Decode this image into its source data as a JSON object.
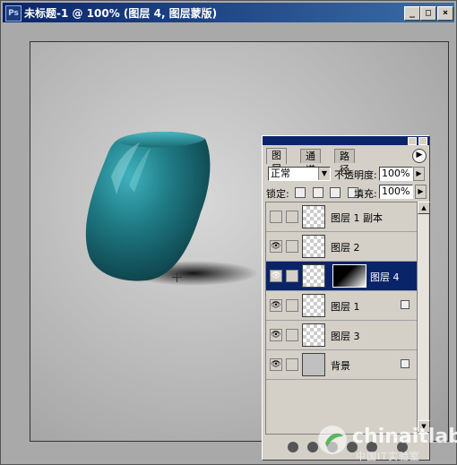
{
  "window": {
    "title": "未标题-1 @ 100% (图层 4, 图层蒙版)",
    "icon": "photoshop-icon",
    "controls": [
      "_",
      "□",
      "×"
    ]
  },
  "layers_panel": {
    "tabs": [
      "图层",
      "通道",
      "路径"
    ],
    "active_tab": "图层",
    "blend_mode": "正常",
    "opacity_label": "不透明度:",
    "opacity_value": "100%",
    "lock_label": "锁定:",
    "fill_label": "填充:",
    "fill_value": "100%",
    "layers": [
      {
        "name": "图层 1 副本",
        "visible": false,
        "thumb": "line",
        "locked": false,
        "selected": false
      },
      {
        "name": "图层 2",
        "visible": true,
        "thumb": "transparent",
        "locked": false,
        "selected": false
      },
      {
        "name": "图层 4",
        "visible": true,
        "thumb": "vase",
        "mask": true,
        "locked": false,
        "selected": true
      },
      {
        "name": "图层 1",
        "visible": true,
        "thumb": "vase",
        "locked": true,
        "selected": false
      },
      {
        "name": "图层 3",
        "visible": true,
        "thumb": "dash",
        "locked": false,
        "selected": false
      },
      {
        "name": "背景",
        "visible": true,
        "thumb": "gray",
        "locked": true,
        "selected": false
      }
    ]
  },
  "watermark": {
    "brand": "chinaitlab",
    "subtitle": "中国IT实验室"
  },
  "colors": {
    "title_bar_start": "#0a246a",
    "title_bar_end": "#3a6ea5",
    "vase_main": "#1f7a84",
    "selection": "#0a246a"
  }
}
